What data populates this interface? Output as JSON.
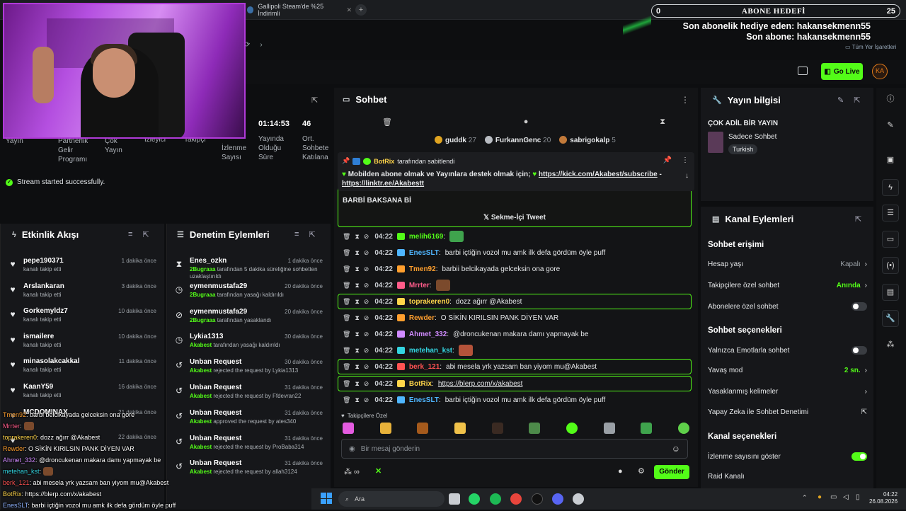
{
  "browser": {
    "tab_title": "Gallipoli Steam'de %25 İndirimli",
    "tab_close": "✕",
    "new_tab": "+",
    "bookmarks_label": "Tüm Yer İşaretleri"
  },
  "goal": {
    "left_value": "0",
    "title": "ABONE HEDEFİ",
    "right_value": "25",
    "last_gift_line": "Son abonelik hediye eden: hakansekmenn55",
    "last_sub_line": "Son abone: hakansekmenn55"
  },
  "header": {
    "go_live": "Go Live"
  },
  "stats": [
    {
      "value": "",
      "label": "Yayın"
    },
    {
      "value": "",
      "label": "Partnerlik Gelir Programı"
    },
    {
      "value": "",
      "label": "Çok Yayın"
    },
    {
      "value": "",
      "label": "İzleyici"
    },
    {
      "value": "",
      "label": "Takipçi"
    },
    {
      "value": "",
      "label": "İzlenme Sayısı"
    },
    {
      "value": "01:14:53",
      "label": "Yayında Olduğu Süre"
    },
    {
      "value": "46",
      "label": "Ort. Sohbete Katılana"
    }
  ],
  "status_message": "Stream started successfully.",
  "activity": {
    "title": "Etkinlik Akışı",
    "items": [
      {
        "name": "pepe190371",
        "sub": "kanalı takip etti",
        "time": "1 dakika önce"
      },
      {
        "name": "Arslankaran",
        "sub": "kanalı takip etti",
        "time": "3 dakika önce"
      },
      {
        "name": "Gorkemyldz7",
        "sub": "kanalı takip etti",
        "time": "10 dakika önce"
      },
      {
        "name": "ismailere",
        "sub": "kanalı takip etti",
        "time": "10 dakika önce"
      },
      {
        "name": "minasolakcakkal",
        "sub": "kanalı takip etti",
        "time": "11 dakika önce"
      },
      {
        "name": "KaanY59",
        "sub": "kanalı takip etti",
        "time": "16 dakika önce"
      },
      {
        "name": "MCDOMINAX",
        "sub": "",
        "time": "21 dakika önce"
      },
      {
        "name": "",
        "sub": "",
        "time": "22 dakika önce"
      }
    ]
  },
  "moderation": {
    "title": "Denetim Eylemleri",
    "items": [
      {
        "name": "Enes_ozkn",
        "actor": "2Bugraaa",
        "sub": "tarafından 5 dakika süreliğine sohbetten uzaklaştırıldı",
        "time": "1 dakika önce"
      },
      {
        "name": "eymenmustafa29",
        "actor": "2Bugraaa",
        "sub": "tarafından yasağı kaldırıldı",
        "time": "20 dakika önce"
      },
      {
        "name": "eymenmustafa29",
        "actor": "2Bugraaa",
        "sub": "tarafından yasaklandı",
        "time": "20 dakika önce"
      },
      {
        "name": "Lykia1313",
        "actor": "Akabest",
        "sub": "tarafından yasağı kaldırıldı",
        "time": "30 dakika önce"
      },
      {
        "name": "Unban Request",
        "actor": "Akabest",
        "sub": "rejected the request by Lykia1313",
        "time": "30 dakika önce"
      },
      {
        "name": "Unban Request",
        "actor": "Akabest",
        "sub": "rejected the request by Ffdevran22",
        "time": "31 dakika önce"
      },
      {
        "name": "Unban Request",
        "actor": "Akabest",
        "sub": "approved the request by ates340",
        "time": "31 dakika önce"
      },
      {
        "name": "Unban Request",
        "actor": "Akabest",
        "sub": "rejected the request by ProBaba314",
        "time": "31 dakika önce"
      },
      {
        "name": "Unban Request",
        "actor": "Akabest",
        "sub": "rejected the request by allah3124",
        "time": "31 dakika önce"
      }
    ]
  },
  "overlay_chat": [
    {
      "user": "Tmen92",
      "text": ": barbi belcikayada gelceksin ona gore",
      "color": "#ff9f2e"
    },
    {
      "user": "Mrrter",
      "text": ":",
      "color": "#ff5c8a"
    },
    {
      "user": "toprakeren0",
      "text": ": dozz ağırr @Akabest",
      "color": "#ffd54a"
    },
    {
      "user": "Rewder",
      "text": ": O SİKİN KIRILSIN PANK DİYEN VAR",
      "color": "#ff9f2e"
    },
    {
      "user": "Ahmet_332",
      "text": ": @droncukenan makara damı yapmayak be",
      "color": "#d08bff"
    },
    {
      "user": "metehan_kst",
      "text": ":",
      "color": "#33d4e0"
    },
    {
      "user": "berk_121",
      "text": ": abi mesela yrk yazsam ban yiyom mu@Akabest",
      "color": "#ff5252"
    },
    {
      "user": "BotRix",
      "text": ": https://blerp.com/x/akabest",
      "color": "#ffd54a"
    },
    {
      "user": "EnesSLT",
      "text": ": barbi içtiğin vozol mu amk ilk defa gördüm öyle puff",
      "color": "#8fb3ff"
    }
  ],
  "chat": {
    "title": "Sohbet",
    "gifters": [
      {
        "name": "guddk",
        "count": "27"
      },
      {
        "name": "FurkannGenc",
        "count": "20"
      },
      {
        "name": "sabrigokalp",
        "count": "5"
      }
    ],
    "pinned_by": "BotRix",
    "pinned_by_suffix": "tarafından sabitlendi",
    "pinned_text": "Mobilden abone olmak ve Yayınlara destek olmak için;",
    "pinned_link1": "https://kick.com/Akabest/subscribe",
    "pinned_sep": "-",
    "pinned_link2": "https://linktr.ee/Akabestt",
    "tweet_text": "BARBİ BAKSANA Bİ",
    "tweet_button": "Sekme-İçi Tweet",
    "messages": [
      {
        "time": "04:22",
        "user": "melih6169",
        "text": "",
        "color": "#53fc18"
      },
      {
        "time": "04:22",
        "user": "EnesSLT",
        "text": "barbi içtiğin vozol mu amk ilk defa gördüm öyle puff",
        "color": "#4fb6ff"
      },
      {
        "time": "04:22",
        "user": "Tmen92",
        "text": "barbii belcikayada gelceksin ona gore",
        "color": "#ff9f2e"
      },
      {
        "time": "04:22",
        "user": "Mrrter",
        "text": "",
        "color": "#ff5c8a"
      },
      {
        "time": "04:22",
        "user": "toprakeren0",
        "text": "dozz ağırr @Akabest",
        "color": "#ffd54a"
      },
      {
        "time": "04:22",
        "user": "Rewder",
        "text": "O SİKİN KIRILSIN PANK DİYEN VAR",
        "color": "#ff9f2e"
      },
      {
        "time": "04:22",
        "user": "Ahmet_332",
        "text": "@droncukenan makara damı yapmayak be",
        "color": "#d08bff"
      },
      {
        "time": "04:22",
        "user": "metehan_kst",
        "text": "",
        "color": "#33d4e0"
      },
      {
        "time": "04:22",
        "user": "berk_121",
        "text": "abi mesela yrk yazsam ban yiyom mu@Akabest",
        "color": "#ff5252"
      },
      {
        "time": "04:22",
        "user": "BotRix",
        "text": "https://blerp.com/x/akabest",
        "color": "#ffd54a"
      },
      {
        "time": "04:22",
        "user": "EnesSLT",
        "text": "barbi içtiğin vozol mu amk ilk defa gördüm öyle puff",
        "color": "#4fb6ff"
      }
    ],
    "followers_only": "Takipçilere Özel",
    "input_placeholder": "Bir mesaj gönderin",
    "send": "Gönder"
  },
  "stream_info": {
    "title": "Yayın bilgisi",
    "stream_title": "ÇOK ADİL BİR YAYIN",
    "category": "Sadece Sohbet",
    "tag": "Turkish"
  },
  "channel_actions": {
    "title": "Kanal Eylemleri",
    "section_access": "Sohbet erişimi",
    "account_age": {
      "label": "Hesap yaşı",
      "value": "Kapalı"
    },
    "followers_chat": {
      "label": "Takipçilere özel sohbet",
      "value": "Anında"
    },
    "subs_chat": {
      "label": "Abonelere özel sohbet"
    },
    "section_chat": "Sohbet seçenekleri",
    "emote_only": {
      "label": "Yalnızca Emotlarla sohbet"
    },
    "slow_mode": {
      "label": "Yavaş mod",
      "value": "2 sn."
    },
    "banned_words": {
      "label": "Yasaklanmış kelimeler"
    },
    "ai_moderation": {
      "label": "Yapay Zeka ile Sohbet Denetimi"
    },
    "section_channel": "Kanal seçenekleri",
    "show_views": {
      "label": "İzlenme sayısını göster"
    },
    "raid": {
      "label": "Raid Kanalı"
    }
  },
  "taskbar": {
    "search": "Ara",
    "time": "04:22",
    "date": "26.08.2026"
  },
  "colors": {
    "accent": "#53fc18",
    "panel": "#16171a",
    "background": "#0d0e10"
  }
}
